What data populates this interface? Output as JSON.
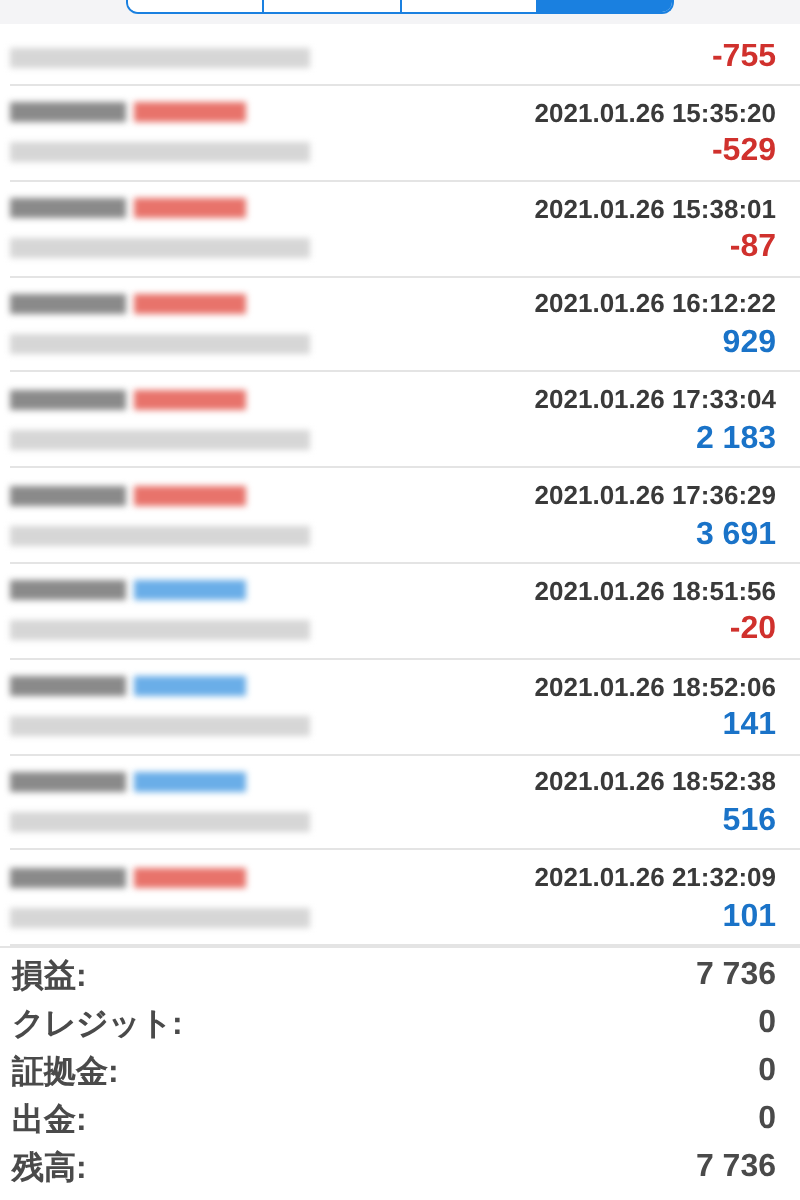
{
  "tabs": [
    {
      "selected": false
    },
    {
      "selected": false
    },
    {
      "selected": false
    },
    {
      "selected": true
    }
  ],
  "deals": [
    {
      "profit": "-755",
      "color": "#d0312d"
    },
    {
      "kind": "sell",
      "date": "2021.01.26 15:35:20",
      "profit": "-529",
      "color": "#d0312d"
    },
    {
      "kind": "sell",
      "date": "2021.01.26 15:38:01",
      "profit": "-87",
      "color": "#d0312d"
    },
    {
      "kind": "sell",
      "date": "2021.01.26 16:12:22",
      "profit": "929",
      "color": "#1a73c8"
    },
    {
      "kind": "sell",
      "date": "2021.01.26 17:33:04",
      "profit": "2 183",
      "color": "#1a73c8"
    },
    {
      "kind": "sell",
      "date": "2021.01.26 17:36:29",
      "profit": "3 691",
      "color": "#1a73c8"
    },
    {
      "kind": "buy",
      "date": "2021.01.26 18:51:56",
      "profit": "-20",
      "color": "#d0312d"
    },
    {
      "kind": "buy",
      "date": "2021.01.26 18:52:06",
      "profit": "141",
      "color": "#1a73c8"
    },
    {
      "kind": "buy",
      "date": "2021.01.26 18:52:38",
      "profit": "516",
      "color": "#1a73c8"
    },
    {
      "kind": "sell",
      "date": "2021.01.26 21:32:09",
      "profit": "101",
      "color": "#1a73c8"
    }
  ],
  "summary": [
    {
      "label": "損益:",
      "value": "7 736"
    },
    {
      "label": "クレジット:",
      "value": "0"
    },
    {
      "label": "証拠金:",
      "value": "0"
    },
    {
      "label": "出金:",
      "value": "0"
    },
    {
      "label": "残高:",
      "value": "7 736"
    }
  ]
}
